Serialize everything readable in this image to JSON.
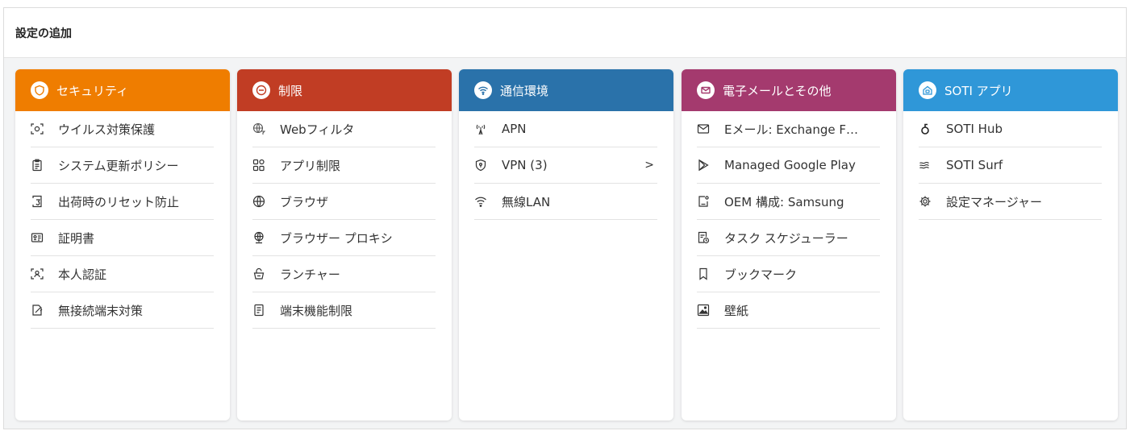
{
  "page": {
    "title": "設定の追加"
  },
  "categories": [
    {
      "title": "セキュリティ",
      "color": "#ef7d00",
      "icon": "shield-icon",
      "items": [
        {
          "label": "ウイルス対策保護",
          "icon": "virus-scan-icon"
        },
        {
          "label": "システム更新ポリシー",
          "icon": "clipboard-icon"
        },
        {
          "label": "出荷時のリセット防止",
          "icon": "reset-icon"
        },
        {
          "label": "証明書",
          "icon": "certificate-icon"
        },
        {
          "label": "本人認証",
          "icon": "identity-icon"
        },
        {
          "label": "無接続端末対策",
          "icon": "disconnected-device-icon"
        }
      ]
    },
    {
      "title": "制限",
      "color": "#c13d24",
      "icon": "no-entry-icon",
      "items": [
        {
          "label": "Webフィルタ",
          "icon": "web-filter-icon"
        },
        {
          "label": "アプリ制限",
          "icon": "apps-grid-icon"
        },
        {
          "label": "ブラウザ",
          "icon": "globe-icon"
        },
        {
          "label": "ブラウザー プロキシ",
          "icon": "proxy-globe-icon"
        },
        {
          "label": "ランチャー",
          "icon": "launcher-icon"
        },
        {
          "label": "端末機能制限",
          "icon": "device-features-icon"
        }
      ]
    },
    {
      "title": "通信環境",
      "color": "#2a72aa",
      "icon": "wifi-icon",
      "items": [
        {
          "label": "APN",
          "icon": "antenna-icon"
        },
        {
          "label": "VPN (3)",
          "icon": "vpn-shield-icon",
          "chevron": ">"
        },
        {
          "label": "無線LAN",
          "icon": "wifi-icon"
        }
      ]
    },
    {
      "title": "電子メールとその他",
      "color": "#a43a6e",
      "icon": "mail-icon",
      "items": [
        {
          "label": "Eメール: Exchange F…",
          "icon": "mail-icon"
        },
        {
          "label": "Managed Google Play",
          "icon": "play-icon"
        },
        {
          "label": "OEM 構成: Samsung",
          "icon": "phone-config-icon"
        },
        {
          "label": "タスク スケジューラー",
          "icon": "task-scheduler-icon"
        },
        {
          "label": "ブックマーク",
          "icon": "bookmark-icon"
        },
        {
          "label": "壁紙",
          "icon": "wallpaper-icon"
        }
      ]
    },
    {
      "title": "SOTI アプリ",
      "color": "#2f97d8",
      "icon": "soti-app-icon",
      "items": [
        {
          "label": "SOTI Hub",
          "icon": "soti-hub-icon"
        },
        {
          "label": "SOTI Surf",
          "icon": "soti-surf-icon"
        },
        {
          "label": "設定マネージャー",
          "icon": "gear-icon"
        }
      ]
    }
  ]
}
